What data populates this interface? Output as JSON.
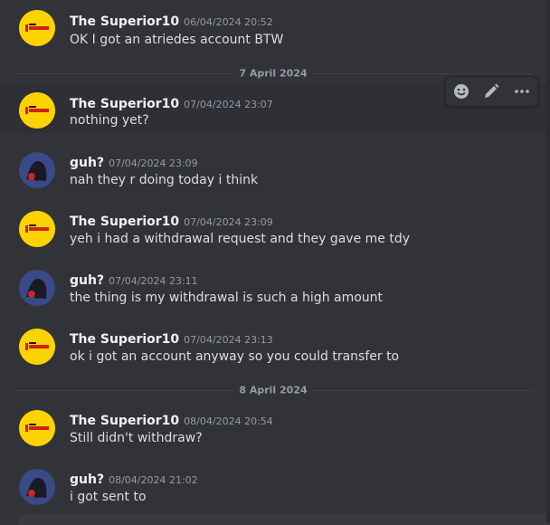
{
  "messages": [
    {
      "username": "The Superior10",
      "timestamp": "06/04/2024 20:52",
      "text": "OK I got an atriedes account BTW"
    },
    {
      "username": "The Superior10",
      "timestamp": "07/04/2024 23:07",
      "text": "nothing yet?"
    },
    {
      "username": "guh?",
      "timestamp": "07/04/2024 23:09",
      "text": "nah they r doing today i think"
    },
    {
      "username": "The Superior10",
      "timestamp": "07/04/2024 23:09",
      "text": "yeh i had a withdrawal request and they gave me tdy"
    },
    {
      "username": "guh?",
      "timestamp": "07/04/2024 23:11",
      "text": "the thing is my withdrawal is such a high amount"
    },
    {
      "username": "The Superior10",
      "timestamp": "07/04/2024 23:13",
      "text": "ok i got an account anyway so you could transfer to"
    },
    {
      "username": "The Superior10",
      "timestamp": "08/04/2024 20:54",
      "text": "Still didn't withdraw?"
    },
    {
      "username": "guh?",
      "timestamp": "08/04/2024 21:02",
      "text": "i got sent to"
    }
  ],
  "dividers": [
    "7 April 2024",
    "8 April 2024"
  ],
  "toolbar": {
    "icons": [
      "add-reaction-icon",
      "edit-icon",
      "more-icon"
    ]
  },
  "colors": {
    "background": "#313338",
    "username": "#f2f3f5",
    "text": "#dbdee1",
    "timestamp": "#949ba4",
    "avatar_yellow": "#fbd400"
  }
}
